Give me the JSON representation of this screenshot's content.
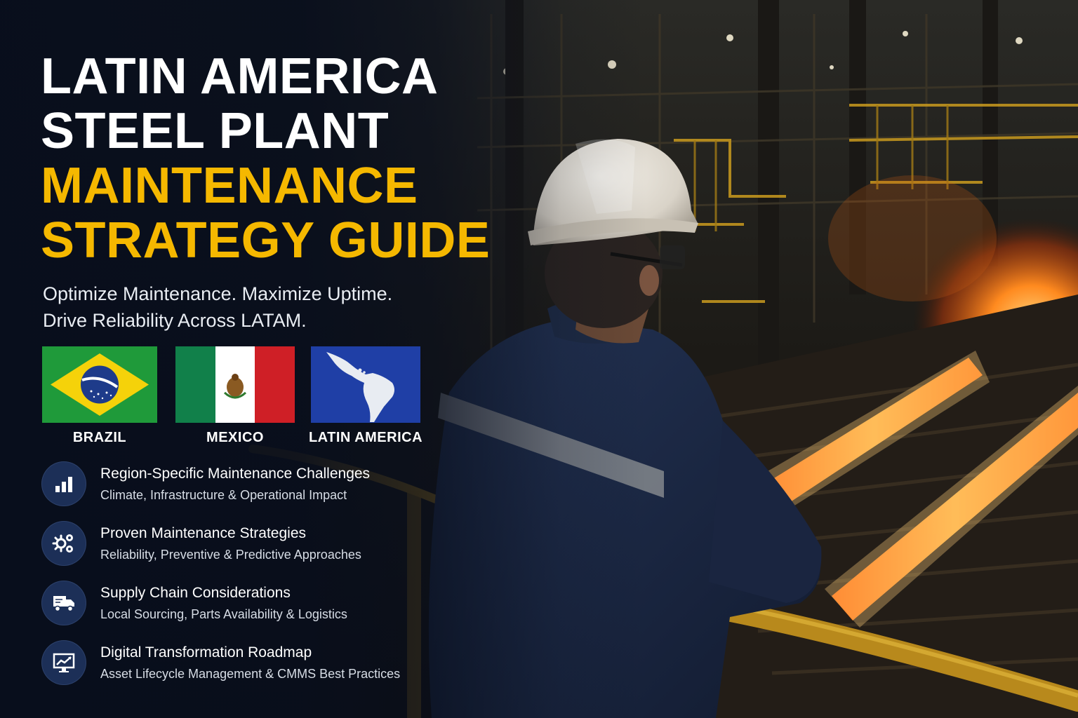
{
  "title": {
    "line1": "LATIN AMERICA",
    "line2": "STEEL PLANT",
    "line3": "MAINTENANCE",
    "line4": "STRATEGY GUIDE"
  },
  "tagline": {
    "line1": "Optimize Maintenance. Maximize Uptime.",
    "line2": "Drive Reliability Across LATAM."
  },
  "flags": [
    {
      "label": "BRAZIL",
      "icon": "brazil-flag"
    },
    {
      "label": "MEXICO",
      "icon": "mexico-flag"
    },
    {
      "label": "LATIN AMERICA",
      "icon": "latin-america-map"
    }
  ],
  "features": [
    {
      "heading": "Region-Specific Maintenance Challenges",
      "sub": "Climate, Infrastructure & Operational Impact",
      "icon": "bar-chart-icon"
    },
    {
      "heading": "Proven Maintenance Strategies",
      "sub": "Reliability, Preventive & Predictive Approaches",
      "icon": "gears-icon"
    },
    {
      "heading": "Supply Chain Considerations",
      "sub": "Local Sourcing, Parts Availability & Logistics",
      "icon": "delivery-truck-icon"
    },
    {
      "heading": "Digital Transformation Roadmap",
      "sub": "Asset Lifecycle Management & CMMS Best Practices",
      "icon": "monitor-chart-icon"
    }
  ],
  "colors": {
    "accent": "#f5b800",
    "navy": "#0b1220",
    "badge": "#1c2f57",
    "molten": "#ff7a1a"
  }
}
